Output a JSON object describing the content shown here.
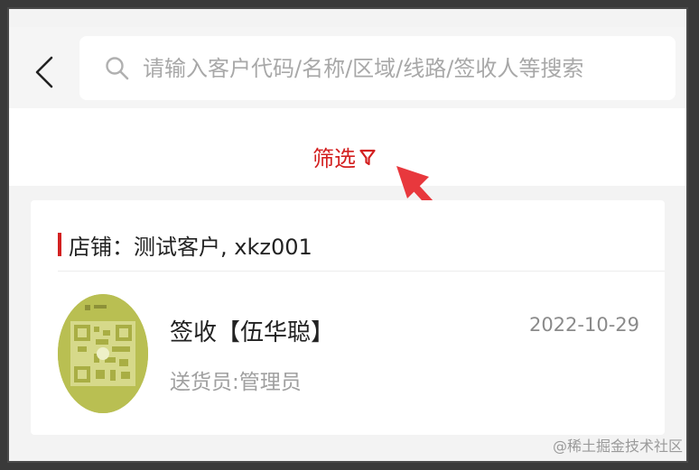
{
  "header": {
    "back_icon": "chevron-left-icon",
    "search": {
      "icon": "search-icon",
      "placeholder": "请输入客户代码/名称/区域/线路/签收人等搜索",
      "value": ""
    }
  },
  "filter": {
    "label": "筛选",
    "icon": "funnel-icon",
    "color": "#d32020"
  },
  "annotation": {
    "arrow_color": "#e8383d"
  },
  "store": {
    "label": "店铺：测试客户, xkz001",
    "marker_color": "#d32020"
  },
  "records": [
    {
      "avatar": "qr-code-avatar",
      "title": "签收【伍华聪】",
      "date": "2022-10-29",
      "subtitle": "送货员:管理员"
    }
  ],
  "watermark": "@稀土掘金技术社区"
}
